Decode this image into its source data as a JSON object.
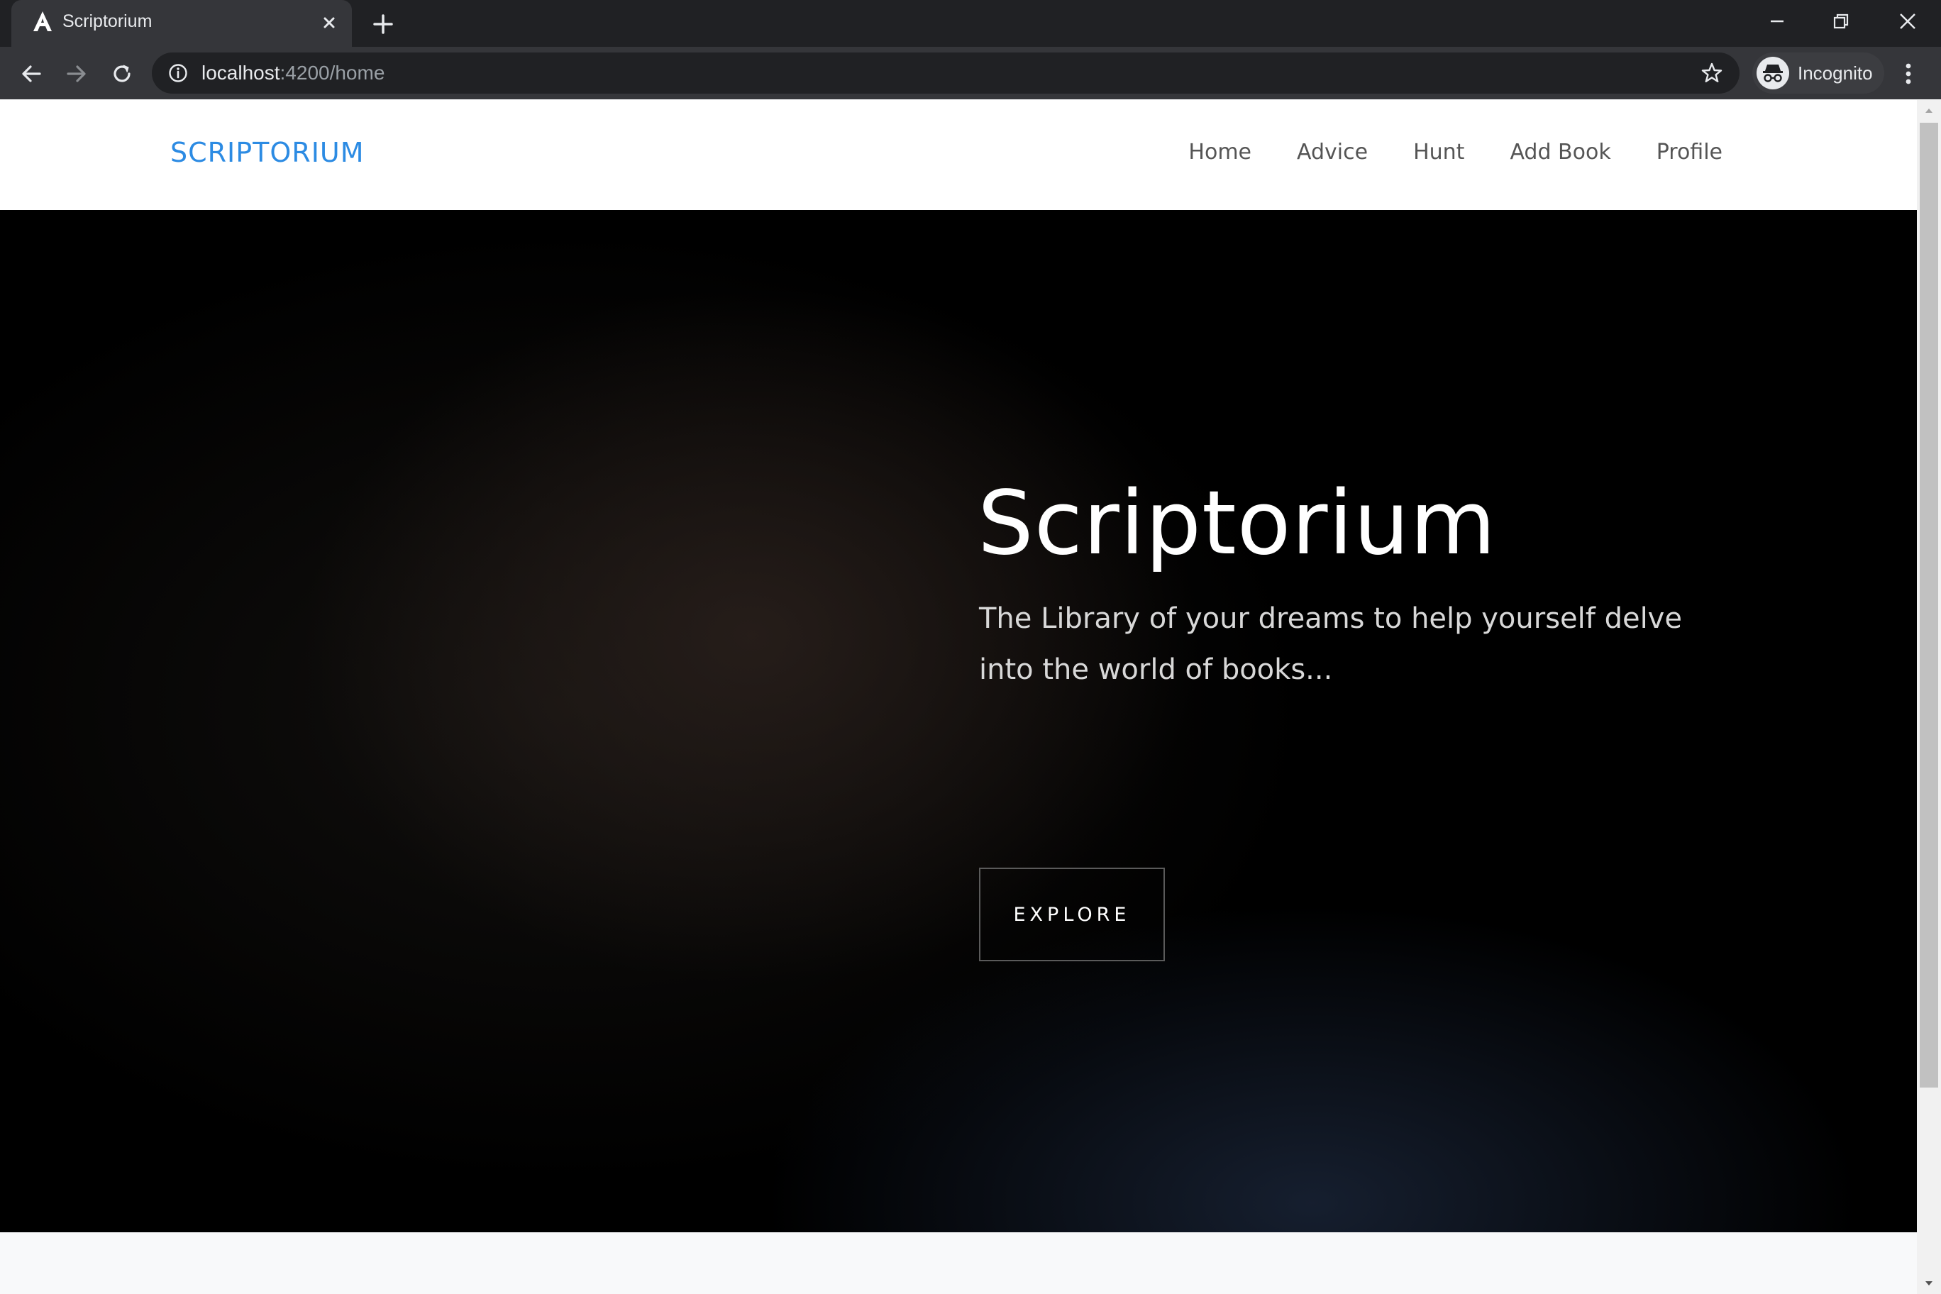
{
  "browser": {
    "tab": {
      "title": "Scriptorium",
      "favicon": "angular-a-icon",
      "close_icon": "close-icon"
    },
    "new_tab_icon": "plus-icon",
    "window_controls": [
      "minimize-icon",
      "restore-icon",
      "close-icon"
    ],
    "toolbar": {
      "back_icon": "arrow-left-icon",
      "forward_icon": "arrow-right-icon",
      "reload_icon": "reload-icon",
      "url_host": "localhost",
      "url_path": ":4200/home",
      "bookmark_icon": "star-icon",
      "profile_label": "Incognito",
      "menu_icon": "kebab-menu-icon"
    }
  },
  "site": {
    "brand": "SCRIPTORIUM",
    "brand_color": "#2c8be3",
    "nav": [
      {
        "label": "Home"
      },
      {
        "label": "Advice"
      },
      {
        "label": "Hunt"
      },
      {
        "label": "Add Book"
      },
      {
        "label": "Profile"
      }
    ]
  },
  "hero": {
    "title": "Scriptorium",
    "subtitle": "The Library of your dreams to help yourself delve into the world of books...",
    "cta_label": "EXPLORE"
  },
  "scrollbar": {
    "scroll_position": 0
  }
}
